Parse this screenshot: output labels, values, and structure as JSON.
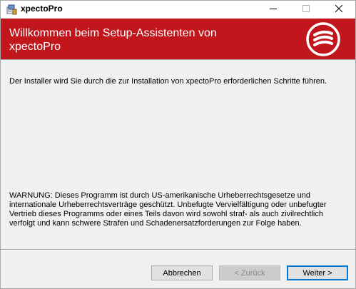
{
  "window": {
    "title": "xpectoPro",
    "icons": {
      "app": "installer-icon",
      "minimize": "minimize-icon",
      "maximize": "maximize-icon",
      "close": "close-icon"
    }
  },
  "banner": {
    "title": "Willkommen beim Setup-Assistenten von xpectoPro",
    "logo": "xpecto-logo",
    "bg_color": "#c0161c"
  },
  "content": {
    "intro": "Der Installer wird Sie durch die zur Installation von xpectoPro erforderlichen Schritte führen.",
    "warning": "WARNUNG: Dieses Programm ist durch US-amerikanische Urheberrechtsgesetze und internationale Urheberrechtsverträge geschützt. Unbefugte Vervielfältigung oder unbefugter Vertrieb dieses Programms oder eines Teils davon wird sowohl straf- als auch zivilrechtlich verfolgt und kann schwere Strafen und Schadenersatzforderungen zur Folge haben."
  },
  "buttons": {
    "cancel": "Abbrechen",
    "back": "< Zurück",
    "next": "Weiter >"
  }
}
